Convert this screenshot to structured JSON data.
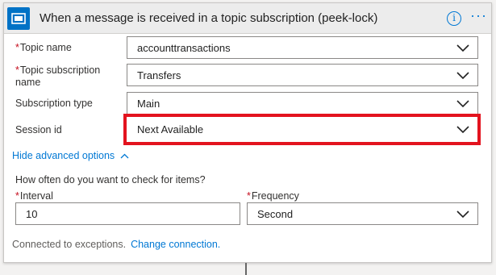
{
  "header": {
    "title": "When a message is received in a topic subscription (peek-lock)",
    "info_label": "i",
    "more_label": "···",
    "trigger_icon": "service-bus-icon",
    "accent": "#0072c6"
  },
  "fields": {
    "topic_name": {
      "label": "Topic name",
      "value": "accounttransactions"
    },
    "topic_subscription": {
      "label_line1": "Topic subscription",
      "label_line2": "name",
      "value": "Transfers"
    },
    "subscription_type": {
      "label": "Subscription type",
      "value": "Main"
    },
    "session_id": {
      "label": "Session id",
      "value": "Next Available"
    }
  },
  "advanced": {
    "toggle_label": "Hide advanced options",
    "question": "How often do you want to check for items?",
    "interval": {
      "label": "Interval",
      "value": "10"
    },
    "frequency": {
      "label": "Frequency",
      "value": "Second"
    }
  },
  "footer": {
    "connected_text": "Connected to exceptions.",
    "change_link": "Change connection."
  },
  "required_marker": "*",
  "highlight_color": "#e3131e"
}
